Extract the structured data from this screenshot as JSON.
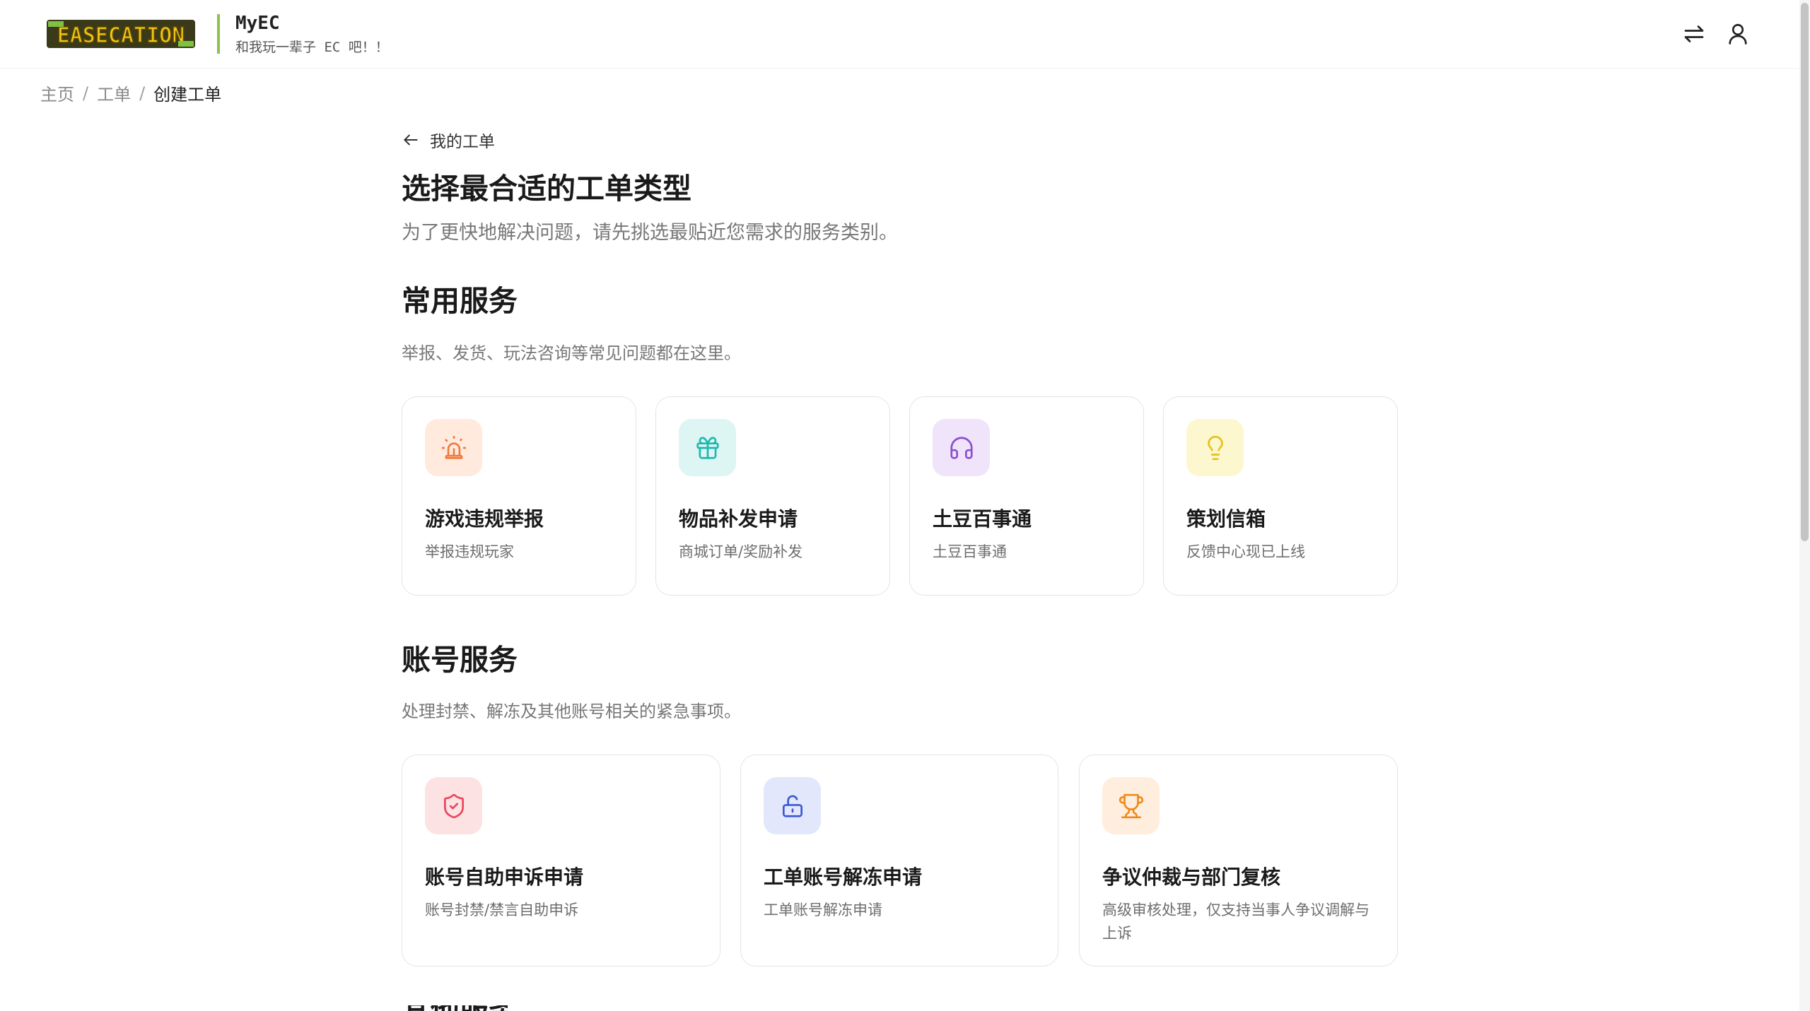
{
  "header": {
    "logo_text": "EASECATION",
    "brand_title": "MyEC",
    "brand_subtitle": "和我玩一辈子 EC 吧！！"
  },
  "icons": {
    "switch": "arrows-switch-icon",
    "user": "user-icon",
    "back": "arrow-left-icon"
  },
  "breadcrumb": {
    "items": [
      "主页",
      "工单",
      "创建工单"
    ],
    "separator": "/"
  },
  "main": {
    "back_label": "我的工单",
    "title": "选择最合适的工单类型",
    "subtitle": "为了更快地解决问题，请先挑选最贴近您需求的服务类别。"
  },
  "sections": [
    {
      "title": "常用服务",
      "description": "举报、发货、玩法咨询等常见问题都在这里。",
      "cards": [
        {
          "title": "游戏违规举报",
          "desc": "举报违规玩家",
          "icon": "siren-icon",
          "color": "#f07a3c",
          "bg": "#ffeadd"
        },
        {
          "title": "物品补发申请",
          "desc": "商城订单/奖励补发",
          "icon": "gift-icon",
          "color": "#1fb8b0",
          "bg": "#ddf5f3"
        },
        {
          "title": "土豆百事通",
          "desc": "土豆百事通",
          "icon": "headphones-icon",
          "color": "#8a4fd0",
          "bg": "#efe4fa"
        },
        {
          "title": "策划信箱",
          "desc": "反馈中心现已上线",
          "icon": "lightbulb-icon",
          "color": "#e3c21a",
          "bg": "#fdf7cf"
        }
      ]
    },
    {
      "title": "账号服务",
      "description": "处理封禁、解冻及其他账号相关的紧急事项。",
      "cards": [
        {
          "title": "账号自助申诉申请",
          "desc": "账号封禁/禁言自助申诉",
          "icon": "shield-check-icon",
          "color": "#e8485a",
          "bg": "#fde2e4"
        },
        {
          "title": "工单账号解冻申请",
          "desc": "工单账号解冻申请",
          "icon": "unlock-icon",
          "color": "#3b59d6",
          "bg": "#e3e7fc"
        },
        {
          "title": "争议仲裁与部门复核",
          "desc": "高级审核处理，仅支持当事人争议调解与上诉",
          "icon": "trophy-icon",
          "color": "#f0891e",
          "bg": "#ffeedd"
        }
      ]
    },
    {
      "title": "其他服务"
    }
  ]
}
